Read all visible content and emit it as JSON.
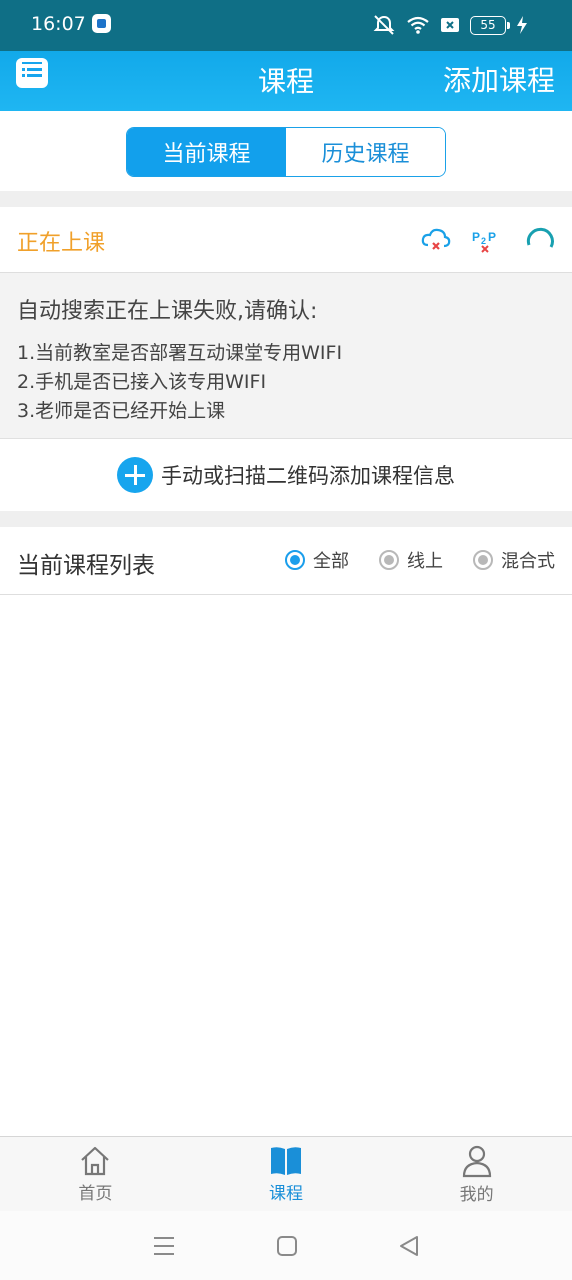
{
  "status": {
    "time": "16:07",
    "battery": "55"
  },
  "header": {
    "title": "课程",
    "add_label": "添加课程"
  },
  "tabs": [
    {
      "label": "当前课程",
      "active": true
    },
    {
      "label": "历史课程",
      "active": false
    }
  ],
  "live": {
    "label": "正在上课",
    "icons": [
      "cloud-error-icon",
      "p2p-error-icon",
      "loading-spinner-icon"
    ]
  },
  "notice": {
    "title": "自动搜索正在上课失败,请确认:",
    "lines": [
      "1.当前教室是否部署互动课堂专用WIFI",
      "2.手机是否已接入该专用WIFI",
      "3.老师是否已经开始上课"
    ]
  },
  "add_course": {
    "label": "手动或扫描二维码添加课程信息"
  },
  "course_list": {
    "title": "当前课程列表",
    "filters": [
      {
        "label": "全部",
        "selected": true
      },
      {
        "label": "线上",
        "selected": false
      },
      {
        "label": "混合式",
        "selected": false
      }
    ]
  },
  "bottom_nav": [
    {
      "label": "首页",
      "icon": "home-icon"
    },
    {
      "label": "课程",
      "icon": "book-icon",
      "active": true
    },
    {
      "label": "我的",
      "icon": "person-icon"
    }
  ],
  "colors": {
    "accent": "#12a0ec",
    "live": "#f0a02a",
    "statusbar": "#0f6f86"
  }
}
